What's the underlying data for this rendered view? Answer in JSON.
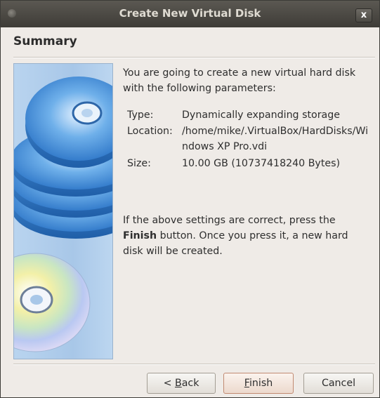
{
  "window": {
    "title": "Create New Virtual Disk",
    "close_label": "x"
  },
  "page": {
    "heading": "Summary"
  },
  "content": {
    "intro": "You are going to create a new virtual hard disk with the following parameters:",
    "params": [
      {
        "label": "Type:",
        "value": "Dynamically expanding storage"
      },
      {
        "label": "Location:",
        "value": "/home/mike/.VirtualBox/HardDisks/Windows XP Pro.vdi"
      },
      {
        "label": "Size:",
        "value": "10.00 GB (10737418240 Bytes)"
      }
    ],
    "outro_before": "If the above settings are correct, press the ",
    "outro_bold": "Finish",
    "outro_after": " button. Once you press it, a new hard disk will be created."
  },
  "buttons": {
    "back": {
      "prefix": "< ",
      "mnemonic": "B",
      "rest": "ack"
    },
    "finish": {
      "mnemonic": "F",
      "rest": "inish"
    },
    "cancel": "Cancel"
  },
  "colors": {
    "titlebar": "#3e3c37",
    "dialog_bg": "#efebe7",
    "art_bg": "#a8c7e8",
    "default_button_border": "#c18a72"
  }
}
